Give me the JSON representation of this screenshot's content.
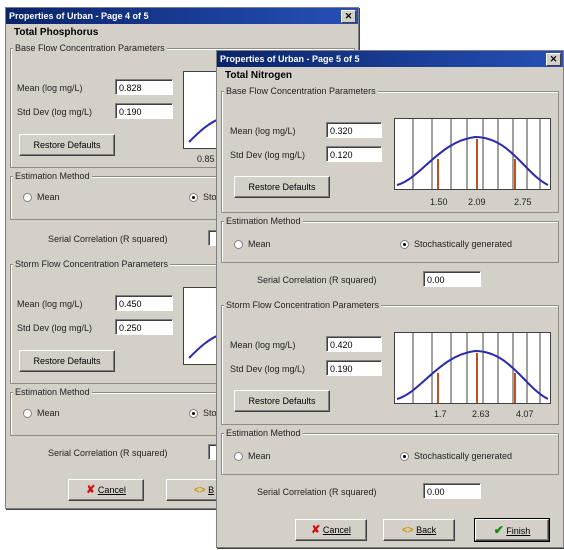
{
  "window1": {
    "title": "Properties of Urban - Page 4 of 5",
    "close": "✕",
    "heading": "Total Phosphorus",
    "base": {
      "group_label": "Base Flow Concentration Parameters",
      "mean_label": "Mean (log mg/L)",
      "mean_value": "0.828",
      "std_label": "Std Dev (log mg/L)",
      "std_value": "0.190",
      "restore_label": "Restore Defaults",
      "tick": "0.85"
    },
    "estimation1": {
      "group_label": "Estimation Method",
      "mean_option": "Mean",
      "stoch_option": "Sto"
    },
    "serial1": {
      "label": "Serial Correlation (R squared)"
    },
    "storm": {
      "group_label": "Storm Flow Concentration Parameters",
      "mean_label": "Mean (log mg/L)",
      "mean_value": "0.450",
      "std_label": "Std Dev (log mg/L)",
      "std_value": "0.250",
      "restore_label": "Restore Defaults"
    },
    "estimation2": {
      "group_label": "Estimation Method",
      "mean_option": "Mean",
      "stoch_option": "Sto"
    },
    "serial2": {
      "label": "Serial Correlation (R squared)"
    },
    "footer": {
      "cancel_icon": "✘",
      "cancel_label": "Cancel",
      "back_icon": "<>",
      "back_label": "B"
    }
  },
  "window2": {
    "title": "Properties of Urban - Page 5 of 5",
    "close": "✕",
    "heading": "Total Nitrogen",
    "base": {
      "group_label": "Base Flow Concentration Parameters",
      "mean_label": "Mean (log mg/L)",
      "mean_value": "0.320",
      "std_label": "Std Dev (log mg/L)",
      "std_value": "0.120",
      "restore_label": "Restore Defaults",
      "ticks": [
        "1.50",
        "2.09",
        "2.75"
      ]
    },
    "estimation1": {
      "group_label": "Estimation Method",
      "mean_option": "Mean",
      "stoch_option": "Stochastically generated",
      "selected": "Stochastically generated"
    },
    "serial1": {
      "label": "Serial Correlation (R squared)",
      "value": "0.00"
    },
    "storm": {
      "group_label": "Storm Flow Concentration Parameters",
      "mean_label": "Mean (log mg/L)",
      "mean_value": "0.420",
      "std_label": "Std Dev (log mg/L)",
      "std_value": "0.190",
      "restore_label": "Restore Defaults",
      "ticks": [
        "1.7",
        "2.63",
        "4.07"
      ]
    },
    "estimation2": {
      "group_label": "Estimation Method",
      "mean_option": "Mean",
      "stoch_option": "Stochastically generated",
      "selected": "Stochastically generated"
    },
    "serial2": {
      "label": "Serial Correlation (R squared)",
      "value": "0.00"
    },
    "footer": {
      "cancel_icon": "✘",
      "cancel_label": "Cancel",
      "back_icon": "<>",
      "back_label": "Back",
      "finish_icon": "✔",
      "finish_label": "Finish"
    }
  },
  "colors": {
    "titlebar": "#0a246a",
    "curve": "#2a2ab0",
    "tail_line": "#c05020",
    "face": "#d4d0c8"
  },
  "icons": [
    "close-icon",
    "cancel-x-icon",
    "back-arrow-icon",
    "finish-check-icon"
  ]
}
